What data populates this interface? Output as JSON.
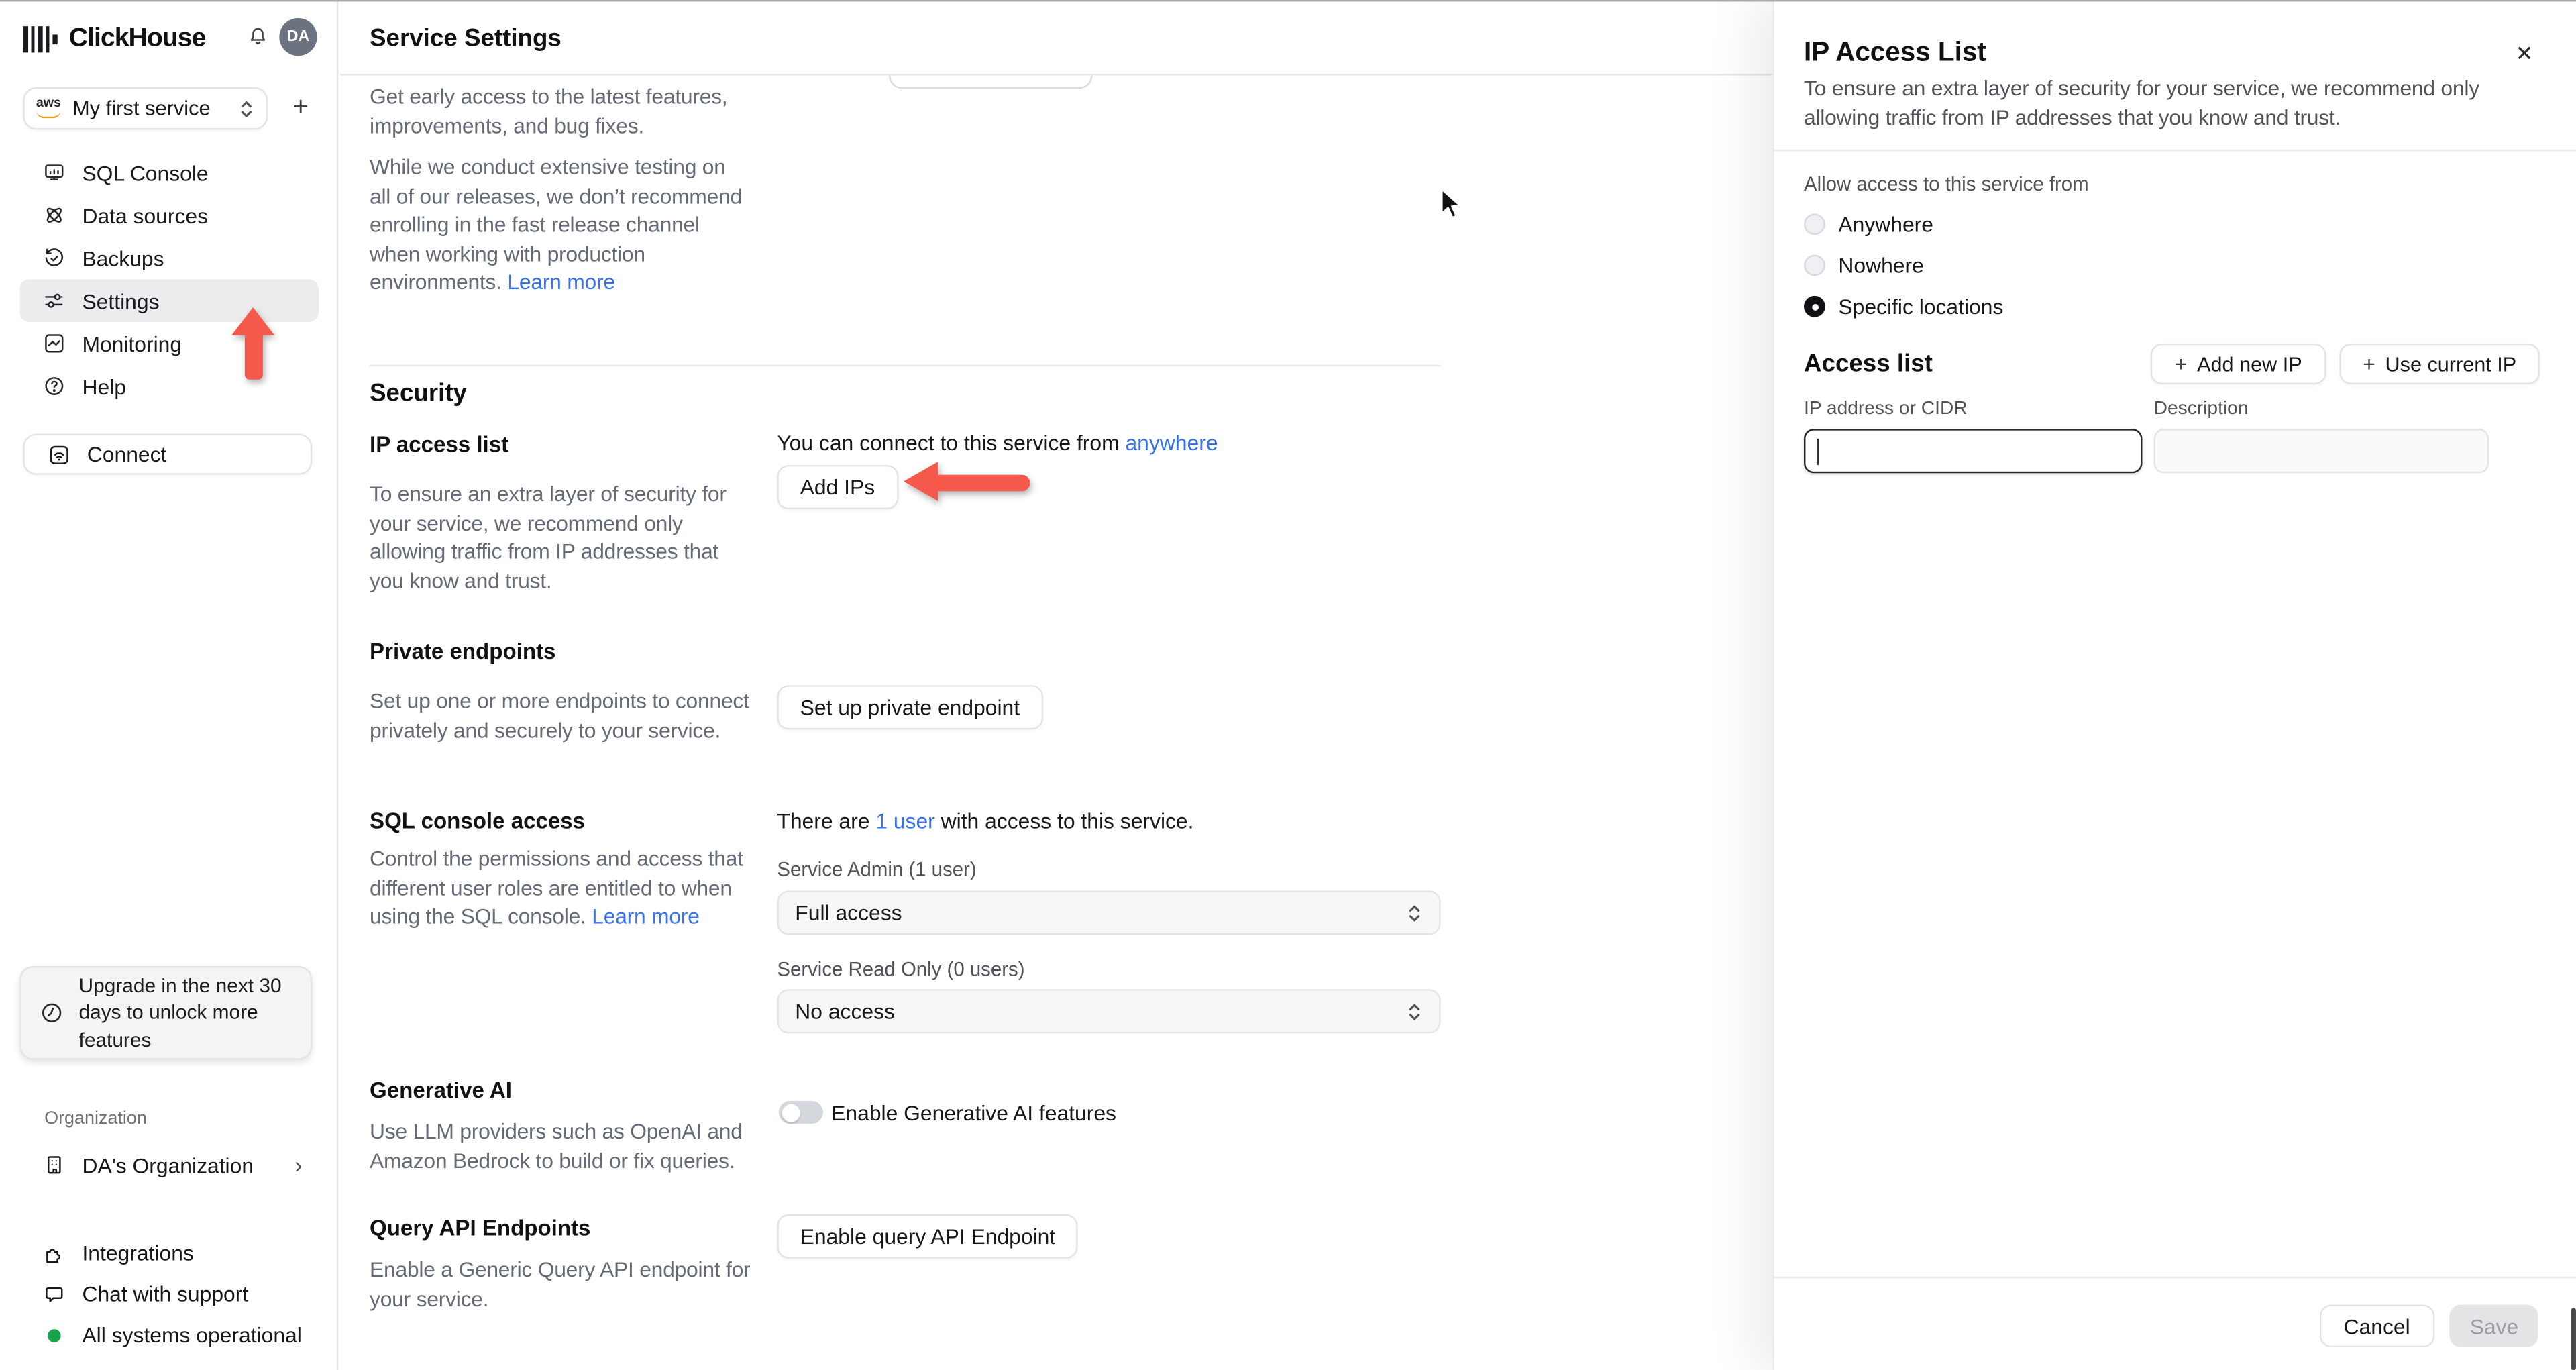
{
  "header": {
    "brand": "ClickHouse",
    "avatar_initials": "DA"
  },
  "sidebar": {
    "service_selector": {
      "provider": "aws",
      "name": "My first service"
    },
    "add_service_label": "+",
    "nav": [
      {
        "label": "SQL Console"
      },
      {
        "label": "Data sources"
      },
      {
        "label": "Backups"
      },
      {
        "label": "Settings"
      },
      {
        "label": "Monitoring"
      },
      {
        "label": "Help"
      }
    ],
    "connect_label": "Connect",
    "upgrade_banner": "Upgrade in the next 30 days to unlock more features",
    "organization_label": "Organization",
    "organization_name": "DA's Organization",
    "org_chevron": "›",
    "footer": [
      {
        "label": "Integrations"
      },
      {
        "label": "Chat with support"
      },
      {
        "label": "All systems operational"
      }
    ]
  },
  "main": {
    "title": "Service Settings",
    "fast_release": {
      "intro": "Get early access to the latest features, improvements, and bug fixes.",
      "body": "While we conduct extensive testing on all of our releases, we don’t recommend enrolling in the fast release channel when working with production environments. ",
      "learn_more": "Learn more"
    },
    "security_heading": "Security",
    "ip_access": {
      "title": "IP access list",
      "description": "To ensure an extra layer of security for your service, we recommend only allowing traffic from IP addresses that you know and trust.",
      "status_prefix": "You can connect to this service from ",
      "status_link": "anywhere",
      "add_button": "Add IPs"
    },
    "private_endpoints": {
      "title": "Private endpoints",
      "description": "Set up one or more endpoints to connect privately and securely to your service.",
      "button": "Set up private endpoint"
    },
    "sql_access": {
      "title": "SQL console access",
      "status_prefix": "There are ",
      "status_link": "1 user",
      "status_suffix": " with access to this service.",
      "description": "Control the permissions and access that different user roles are entitled to when using the SQL console. ",
      "learn_more": "Learn more",
      "admin_label": "Service Admin (1 user)",
      "admin_value": "Full access",
      "readonly_label": "Service Read Only (0 users)",
      "readonly_value": "No access"
    },
    "generative_ai": {
      "title": "Generative AI",
      "description": "Use LLM providers such as OpenAI and Amazon Bedrock to build or fix queries.",
      "toggle_label": "Enable Generative AI features",
      "toggle_on": false
    },
    "query_api": {
      "title": "Query API Endpoints",
      "description": "Enable a Generic Query API endpoint for your service.",
      "button": "Enable query API Endpoint"
    }
  },
  "panel": {
    "title": "IP Access List",
    "close_label": "✕",
    "description": "To ensure an extra layer of security for your service, we recommend only allowing traffic from IP addresses that you know and trust.",
    "allow_label": "Allow access to this service from",
    "options": [
      {
        "label": "Anywhere",
        "selected": false
      },
      {
        "label": "Nowhere",
        "selected": false
      },
      {
        "label": "Specific locations",
        "selected": true
      }
    ],
    "access_list": {
      "heading": "Access list",
      "plus": "+",
      "add_new_button": "Add new IP",
      "use_current_button": "Use current IP",
      "ip_label": "IP address or CIDR",
      "ip_value": "",
      "description_label": "Description",
      "description_value": ""
    },
    "cancel_button": "Cancel",
    "save_button": "Save"
  },
  "colors": {
    "arrow_red": "#f4594c",
    "link_blue": "#3573f0",
    "status_green": "#17a34a",
    "avatar_gray": "#6b7280"
  }
}
